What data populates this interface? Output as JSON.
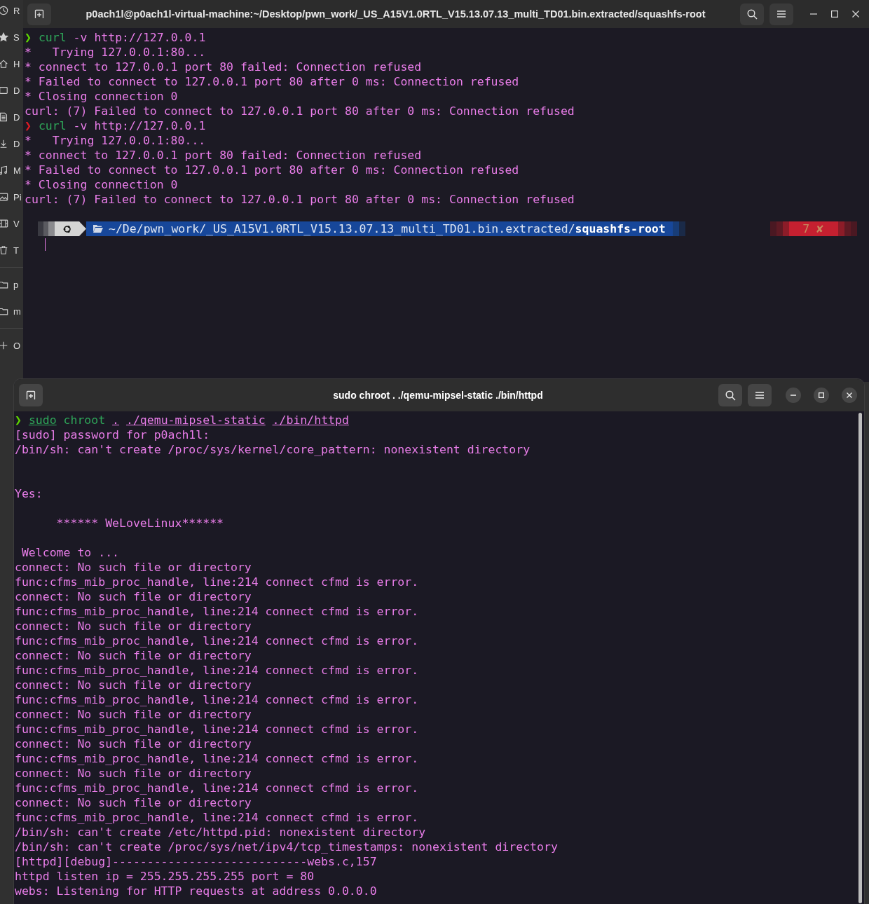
{
  "file_manager": {
    "sidebar": {
      "places": [
        {
          "label": "R"
        },
        {
          "label": "S"
        },
        {
          "label": "H"
        },
        {
          "label": "D"
        },
        {
          "label": "D"
        },
        {
          "label": "D"
        },
        {
          "label": "M"
        },
        {
          "label": "Pi"
        },
        {
          "label": "V"
        },
        {
          "label": "T"
        }
      ],
      "bookmarks": [
        {
          "label": "p"
        },
        {
          "label": "m"
        }
      ],
      "other": [
        {
          "label": "O"
        }
      ]
    }
  },
  "terminal_top": {
    "title": "p0ach1l@p0ach1l-virtual-machine:~/Desktop/pwn_work/_US_A15V1.0RTL_V15.13.07.13_multi_TD01.bin.extracted/squashfs-root",
    "lines": [
      {
        "kind": "command",
        "error": false,
        "symbol": "❯",
        "tokens": [
          {
            "text": "curl",
            "kind": "command",
            "underlined": false
          },
          {
            "text": "-v",
            "kind": "arg",
            "underlined": false
          },
          {
            "text": "http://127.0.0.1",
            "kind": "arg",
            "underlined": false
          }
        ]
      },
      {
        "kind": "output",
        "text": "*   Trying 127.0.0.1:80..."
      },
      {
        "kind": "output",
        "text": "* connect to 127.0.0.1 port 80 failed: Connection refused"
      },
      {
        "kind": "output",
        "text": "* Failed to connect to 127.0.0.1 port 80 after 0 ms: Connection refused"
      },
      {
        "kind": "output",
        "text": "* Closing connection 0"
      },
      {
        "kind": "output",
        "text": "curl: (7) Failed to connect to 127.0.0.1 port 80 after 0 ms: Connection refused"
      },
      {
        "kind": "command",
        "error": true,
        "symbol": "❯",
        "tokens": [
          {
            "text": "curl",
            "kind": "command",
            "underlined": false
          },
          {
            "text": "-v",
            "kind": "arg",
            "underlined": false
          },
          {
            "text": "http://127.0.0.1",
            "kind": "arg",
            "underlined": false
          }
        ]
      },
      {
        "kind": "output",
        "text": "*   Trying 127.0.0.1:80..."
      },
      {
        "kind": "output",
        "text": "* connect to 127.0.0.1 port 80 failed: Connection refused"
      },
      {
        "kind": "output",
        "text": "* Failed to connect to 127.0.0.1 port 80 after 0 ms: Connection refused"
      },
      {
        "kind": "output",
        "text": "* Closing connection 0"
      },
      {
        "kind": "output",
        "text": "curl: (7) Failed to connect to 127.0.0.1 port 80 after 0 ms: Connection refused"
      },
      {
        "kind": "blank"
      },
      {
        "kind": "prompt_bar",
        "path": "~/De/pwn_work/_US_A15V1.0RTL_V15.13.07.13_multi_TD01.bin.extracted/",
        "path_last": "squashfs-root",
        "exit_code": "7",
        "error_mark": "✘"
      }
    ]
  },
  "terminal_bottom": {
    "title": "sudo chroot . ./qemu-mipsel-static ./bin/httpd",
    "lines": [
      {
        "kind": "command",
        "error": false,
        "symbol": "❯",
        "tokens": [
          {
            "text": "sudo",
            "kind": "command",
            "underlined": true
          },
          {
            "text": "chroot",
            "kind": "command",
            "underlined": false
          },
          {
            "text": ".",
            "kind": "arg",
            "underlined": true
          },
          {
            "text": "./qemu-mipsel-static",
            "kind": "arg",
            "underlined": true
          },
          {
            "text": "./bin/httpd",
            "kind": "arg",
            "underlined": true
          }
        ]
      },
      {
        "kind": "output",
        "text": "[sudo] password for p0ach1l:"
      },
      {
        "kind": "output",
        "text": "/bin/sh: can't create /proc/sys/kernel/core_pattern: nonexistent directory"
      },
      {
        "kind": "blank"
      },
      {
        "kind": "blank"
      },
      {
        "kind": "output",
        "text": "Yes:"
      },
      {
        "kind": "blank"
      },
      {
        "kind": "output",
        "text": "      ****** WeLoveLinux******"
      },
      {
        "kind": "blank"
      },
      {
        "kind": "output",
        "text": " Welcome to ..."
      },
      {
        "kind": "output",
        "text": "connect: No such file or directory"
      },
      {
        "kind": "output",
        "text": "func:cfms_mib_proc_handle, line:214 connect cfmd is error."
      },
      {
        "kind": "output",
        "text": "connect: No such file or directory"
      },
      {
        "kind": "output",
        "text": "func:cfms_mib_proc_handle, line:214 connect cfmd is error."
      },
      {
        "kind": "output",
        "text": "connect: No such file or directory"
      },
      {
        "kind": "output",
        "text": "func:cfms_mib_proc_handle, line:214 connect cfmd is error."
      },
      {
        "kind": "output",
        "text": "connect: No such file or directory"
      },
      {
        "kind": "output",
        "text": "func:cfms_mib_proc_handle, line:214 connect cfmd is error."
      },
      {
        "kind": "output",
        "text": "connect: No such file or directory"
      },
      {
        "kind": "output",
        "text": "func:cfms_mib_proc_handle, line:214 connect cfmd is error."
      },
      {
        "kind": "output",
        "text": "connect: No such file or directory"
      },
      {
        "kind": "output",
        "text": "func:cfms_mib_proc_handle, line:214 connect cfmd is error."
      },
      {
        "kind": "output",
        "text": "connect: No such file or directory"
      },
      {
        "kind": "output",
        "text": "func:cfms_mib_proc_handle, line:214 connect cfmd is error."
      },
      {
        "kind": "output",
        "text": "connect: No such file or directory"
      },
      {
        "kind": "output",
        "text": "func:cfms_mib_proc_handle, line:214 connect cfmd is error."
      },
      {
        "kind": "output",
        "text": "connect: No such file or directory"
      },
      {
        "kind": "output",
        "text": "func:cfms_mib_proc_handle, line:214 connect cfmd is error."
      },
      {
        "kind": "output",
        "text": "/bin/sh: can't create /etc/httpd.pid: nonexistent directory"
      },
      {
        "kind": "output",
        "text": "/bin/sh: can't create /proc/sys/net/ipv4/tcp_timestamps: nonexistent directory"
      },
      {
        "kind": "output",
        "text": "[httpd][debug]----------------------------webs.c,157"
      },
      {
        "kind": "output",
        "text": "httpd listen ip = 255.255.255.255 port = 80"
      },
      {
        "kind": "output",
        "text": "webs: Listening for HTTP requests at address 0.0.0.0"
      }
    ]
  }
}
